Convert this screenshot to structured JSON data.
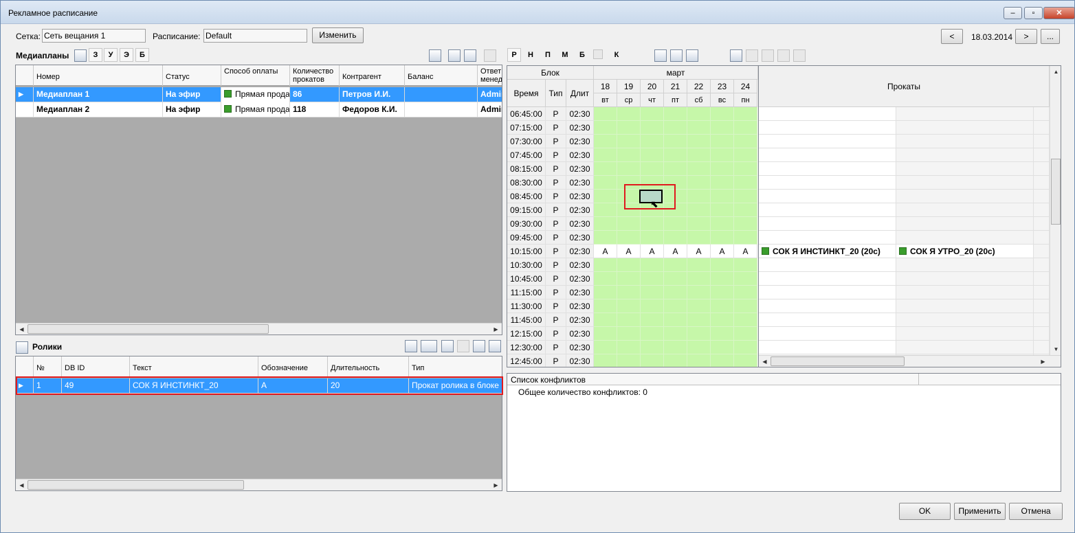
{
  "window": {
    "title": "Рекламное расписание",
    "min": "‒",
    "max": "▫",
    "close": "✕"
  },
  "top": {
    "network_label": "Сетка:",
    "network_value": "Сеть вещания 1",
    "schedule_label": "Расписание:",
    "schedule_value": "Default",
    "change_button": "Изменить",
    "prev": "<",
    "date": "18.03.2014",
    "next": ">",
    "more": "..."
  },
  "mediaplans": {
    "title": "Медиапланы",
    "filters": [
      "З",
      "У",
      "Э",
      "Б"
    ],
    "columns": [
      "Номер",
      "Статус",
      "Способ оплаты",
      "Количество прокатов",
      "Контрагент",
      "Баланс",
      "Ответ менед"
    ],
    "rows": [
      {
        "num": "Медиаплан 1",
        "status": "На эфир",
        "pay": "Прямая продажа",
        "count": "86",
        "contractor": "Петров И.И.",
        "balance": "",
        "manager": "Admin"
      },
      {
        "num": "Медиаплан 2",
        "status": "На эфир",
        "pay": "Прямая продажа",
        "count": "118",
        "contractor": "Федоров К.И.",
        "balance": "",
        "manager": "Admin"
      }
    ]
  },
  "clips": {
    "title": "Ролики",
    "columns": [
      "№",
      "DB ID",
      "Текст",
      "Обозначение",
      "Длительность",
      "Тип"
    ],
    "rows": [
      {
        "n": "1",
        "dbid": "49",
        "text": "СОК Я ИНСТИНКТ_20",
        "mark": "А",
        "dur": "20",
        "type": "Прокат ролика в блоке"
      }
    ]
  },
  "schedule": {
    "day_filters": [
      "Р",
      "Н",
      "П",
      "М",
      "Б",
      "К"
    ],
    "headers": {
      "block": "Блок",
      "time": "Время",
      "type": "Тип",
      "dur": "Длит",
      "month": "март",
      "rentals": "Прокаты"
    },
    "days": [
      {
        "d": "18",
        "w": "вт"
      },
      {
        "d": "19",
        "w": "ср"
      },
      {
        "d": "20",
        "w": "чт"
      },
      {
        "d": "21",
        "w": "пт"
      },
      {
        "d": "22",
        "w": "сб"
      },
      {
        "d": "23",
        "w": "вс"
      },
      {
        "d": "24",
        "w": "пн"
      }
    ],
    "rows": [
      {
        "time": "06:45:00",
        "type": "Р",
        "dur": "02:30"
      },
      {
        "time": "07:15:00",
        "type": "Р",
        "dur": "02:30"
      },
      {
        "time": "07:30:00",
        "type": "Р",
        "dur": "02:30"
      },
      {
        "time": "07:45:00",
        "type": "Р",
        "dur": "02:30"
      },
      {
        "time": "08:15:00",
        "type": "Р",
        "dur": "02:30"
      },
      {
        "time": "08:30:00",
        "type": "Р",
        "dur": "02:30"
      },
      {
        "time": "08:45:00",
        "type": "Р",
        "dur": "02:30"
      },
      {
        "time": "09:15:00",
        "type": "Р",
        "dur": "02:30"
      },
      {
        "time": "09:30:00",
        "type": "Р",
        "dur": "02:30"
      },
      {
        "time": "09:45:00",
        "type": "Р",
        "dur": "02:30"
      },
      {
        "time": "10:15:00",
        "type": "Р",
        "dur": "02:30"
      },
      {
        "time": "10:30:00",
        "type": "Р",
        "dur": "02:30"
      },
      {
        "time": "10:45:00",
        "type": "Р",
        "dur": "02:30"
      },
      {
        "time": "11:15:00",
        "type": "Р",
        "dur": "02:30"
      },
      {
        "time": "11:30:00",
        "type": "Р",
        "dur": "02:30"
      },
      {
        "time": "11:45:00",
        "type": "Р",
        "dur": "02:30"
      },
      {
        "time": "12:15:00",
        "type": "Р",
        "dur": "02:30"
      },
      {
        "time": "12:30:00",
        "type": "Р",
        "dur": "02:30"
      },
      {
        "time": "12:45:00",
        "type": "Р",
        "dur": "02:30"
      }
    ],
    "filled_row": "10:15:00",
    "filled_mark": "А",
    "rentals": [
      "СОК Я ИНСТИНКТ_20 (20с)",
      "СОК Я УТРО_20 (20с)"
    ]
  },
  "conflicts": {
    "title": "Список конфликтов",
    "total": "Общее количество конфликтов: 0"
  },
  "footer": {
    "ok": "OK",
    "apply": "Применить",
    "cancel": "Отмена"
  }
}
